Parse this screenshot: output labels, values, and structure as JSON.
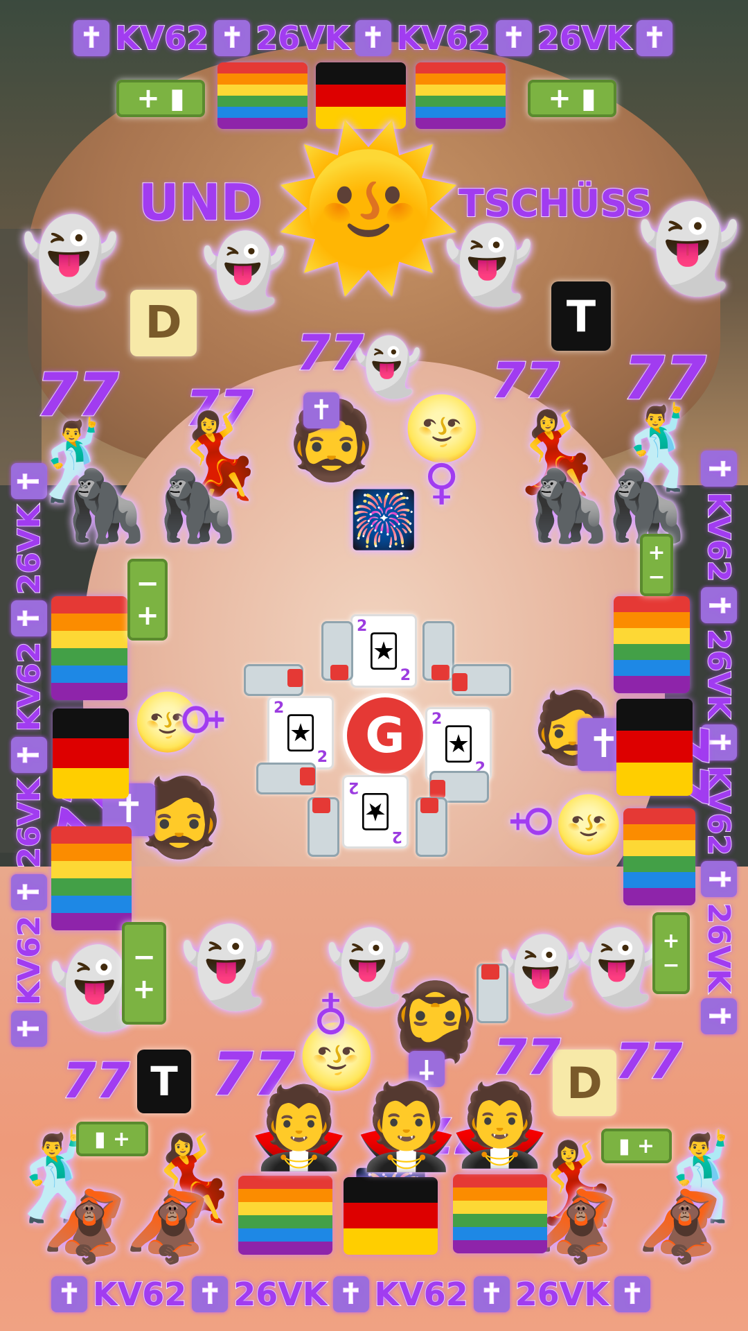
{
  "background": {
    "hair": "#b38055",
    "skin": "#ebc0a8",
    "shirt": "#ee9a7a"
  },
  "ticker": {
    "cross": "✝",
    "a": "KV62",
    "b": "26VK"
  },
  "words": {
    "left": "UND",
    "right": "TSCHÜSS",
    "center_letter": "G",
    "number": "77",
    "tile_d": "D",
    "tile_t": "T",
    "card_value": "2"
  },
  "icons": {
    "sun": "sun-with-face-icon",
    "ghost": "winking-ghost-icon",
    "venus": "venus-moon-icon",
    "gorilla": "gorilla-icon",
    "orangutan": "orangutan-icon",
    "dancer_man": "man-dancing-icon",
    "dancer_woman": "woman-dancing-icon",
    "vampire": "vampire-icon",
    "firework": "fireworks-icon",
    "joker": "joker-card-icon",
    "battery": "battery-icon",
    "person": "bearded-person-icon"
  },
  "colors": {
    "accent": "#a13cf0",
    "cross_tile": "#9b6ddc",
    "battery_green": "#7cb342",
    "red": "#e53935",
    "rainbow": [
      "#e53935",
      "#fb8c00",
      "#fdd835",
      "#43a047",
      "#1e88e5",
      "#8e24aa"
    ],
    "germany": [
      "#111111",
      "#dd0000",
      "#ffce00"
    ]
  }
}
